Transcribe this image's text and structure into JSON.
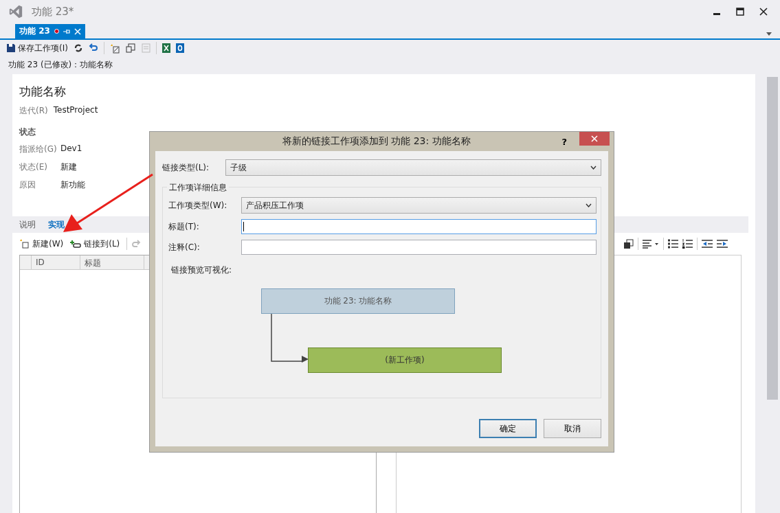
{
  "window": {
    "title": "功能 23*"
  },
  "tabs": [
    {
      "label": "功能 23",
      "selected": true,
      "modified": true
    }
  ],
  "toolbar": {
    "save": "保存工作项(I)"
  },
  "header": "功能 23 (已修改)：功能名称",
  "form": {
    "title": "功能名称",
    "iteration": {
      "label": "迭代(R)",
      "value": "TestProject"
    },
    "section": "状态",
    "fields": [
      {
        "label": "指派给(G)",
        "value": "Dev1"
      },
      {
        "label": "状态(E)",
        "value": "新建"
      },
      {
        "label": "原因",
        "value": "新功能"
      }
    ]
  },
  "form_tabs": [
    {
      "label": "说明",
      "selected": false
    },
    {
      "label": "实现",
      "selected": true
    }
  ],
  "links_toolbar": {
    "new": "新建(W)",
    "link": "链接到(L)"
  },
  "grid": {
    "columns": [
      "ID",
      "标题"
    ]
  },
  "dialog": {
    "title": "将新的链接工作项添加到 功能 23: 功能名称",
    "help": "?",
    "link_type": {
      "label": "链接类型(L):",
      "value": "子级"
    },
    "group": "工作项详细信息",
    "fields": [
      {
        "kind": "select",
        "label": "工作项类型(W):",
        "value": "产品积压工作项"
      },
      {
        "kind": "text",
        "label": "标题(T):",
        "focused": true
      },
      {
        "kind": "text",
        "label": "注释(C):",
        "focused": false
      }
    ],
    "preview_label": "链接预览可视化:",
    "preview": {
      "parent": "功能 23: 功能名称",
      "child": "(新工作项)"
    },
    "buttons": [
      {
        "label": "确定",
        "default": true
      },
      {
        "label": "取消",
        "default": false
      }
    ]
  }
}
